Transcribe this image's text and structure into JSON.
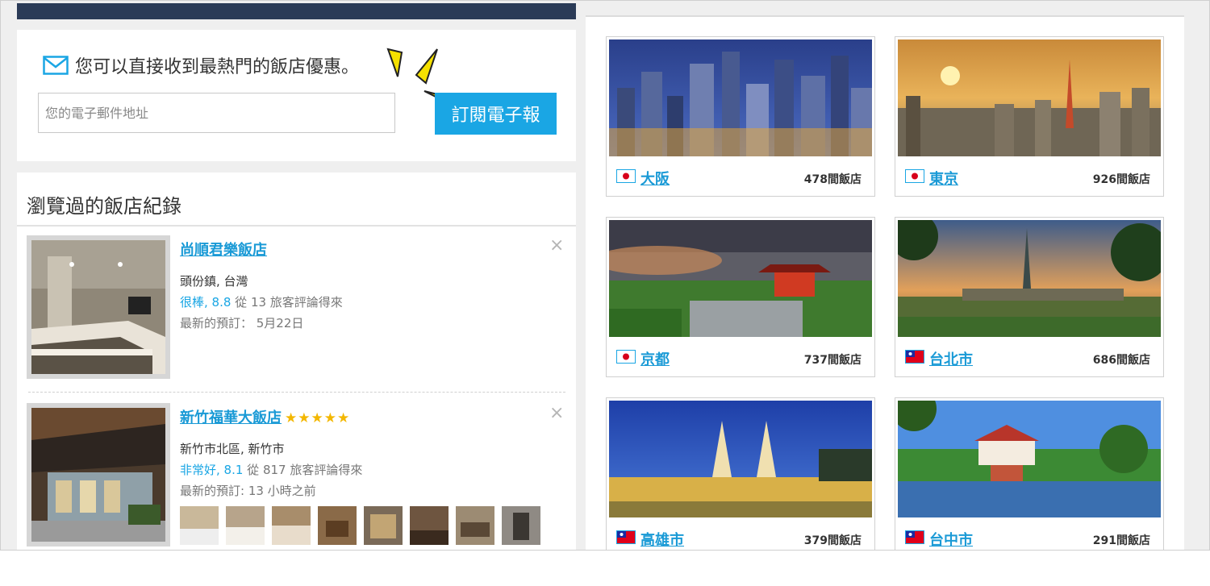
{
  "newsletter": {
    "title": "您可以直接收到最熱門的飯店優惠。",
    "email_placeholder": "您的電子郵件地址",
    "subscribe_label": "訂閱電子報"
  },
  "recent": {
    "title": "瀏覽過的飯店紀錄",
    "hotels": [
      {
        "name": "尚順君樂飯店",
        "stars": "",
        "location": "頭份鎮, 台灣",
        "rating_word": "很棒, 8.8",
        "rating_rest": " 從 13 旅客評論得來",
        "last_booking": "最新的預訂： 5月22日"
      },
      {
        "name": "新竹福華大飯店",
        "stars": "★★★★★",
        "location": "新竹市北區, 新竹市",
        "rating_word": "非常好, 8.1",
        "rating_rest": " 從 817 旅客評論得來",
        "last_booking": "最新的預訂: 13 小時之前"
      }
    ],
    "close_symbol": "×"
  },
  "cities": [
    {
      "name": "大阪",
      "count": "478間飯店",
      "flag": "japan-flag-icon"
    },
    {
      "name": "東京",
      "count": "926間飯店",
      "flag": "japan-flag-icon"
    },
    {
      "name": "京都",
      "count": "737間飯店",
      "flag": "japan-flag-icon"
    },
    {
      "name": "台北市",
      "count": "686間飯店",
      "flag": "taiwan-flag-icon"
    },
    {
      "name": "高雄市",
      "count": "379間飯店",
      "flag": "taiwan-flag-icon"
    },
    {
      "name": "台中市",
      "count": "291間飯店",
      "flag": "taiwan-flag-icon"
    }
  ],
  "colors": {
    "accent": "#1aa6e4",
    "link": "#1a9ad6",
    "header_bar": "#2b3b57",
    "star": "#f3b700"
  }
}
